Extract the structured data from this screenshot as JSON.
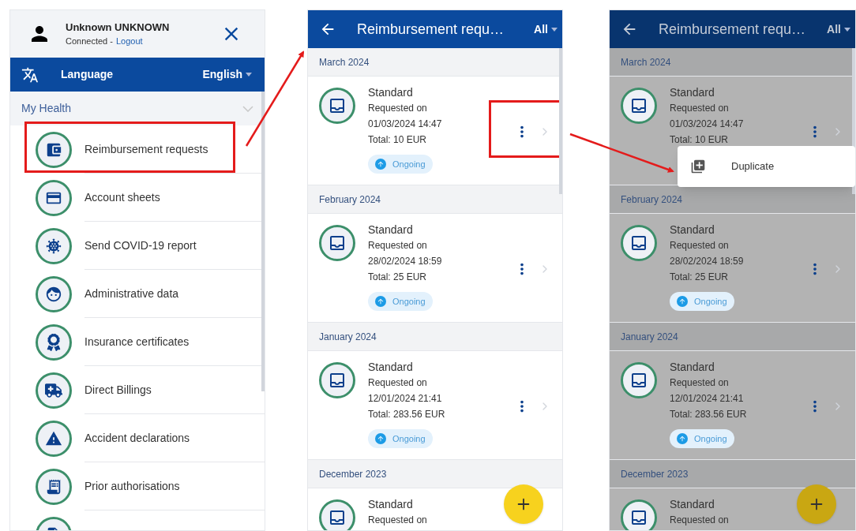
{
  "menu_screen": {
    "user": {
      "name": "Unknown UNKNOWN",
      "status": "Connected -",
      "logout": "Logout"
    },
    "language": {
      "label": "Language",
      "value": "English"
    },
    "section": {
      "title": "My Health",
      "expanded": true
    },
    "items": [
      {
        "kind": "entry",
        "label": "Reimbursement requests",
        "highlighted": true
      },
      {
        "kind": "entry",
        "label": "Account sheets",
        "highlighted": false
      },
      {
        "kind": "entry",
        "label": "Send COVID-19 report",
        "highlighted": false
      },
      {
        "kind": "entry",
        "label": "Administrative data",
        "highlighted": false
      },
      {
        "kind": "entry",
        "label": "Insurance certificates",
        "highlighted": false
      },
      {
        "kind": "entry",
        "label": "Direct Billings",
        "highlighted": false
      },
      {
        "kind": "entry",
        "label": "Accident declarations",
        "highlighted": false
      },
      {
        "kind": "entry",
        "label": "Prior authorisations",
        "highlighted": false
      },
      {
        "kind": "cut"
      }
    ]
  },
  "list_screen": {
    "title": "Reimbursement requ…",
    "filter": "All",
    "dimmed": false,
    "groups": [
      {
        "month": "March 2024",
        "requests": [
          {
            "type": "Standard",
            "requested_label": "Requested on",
            "date": "01/03/2024 14:47",
            "total": "Total: 10 EUR",
            "status": "Ongoing",
            "actions_highlighted": true
          }
        ]
      },
      {
        "month": "February 2024",
        "requests": [
          {
            "type": "Standard",
            "requested_label": "Requested on",
            "date": "28/02/2024 18:59",
            "total": "Total: 25 EUR",
            "status": "Ongoing",
            "actions_highlighted": false
          }
        ]
      },
      {
        "month": "January 2024",
        "requests": [
          {
            "type": "Standard",
            "requested_label": "Requested on",
            "date": "12/01/2024 21:41",
            "total": "Total: 283.56 EUR",
            "status": "Ongoing",
            "actions_highlighted": false
          }
        ]
      },
      {
        "month": "December 2023",
        "requests": [
          {
            "type": "Standard",
            "requested_label": "Requested on",
            "actions_highlighted": false
          }
        ]
      }
    ]
  },
  "dimmed_screen": {
    "title": "Reimbursement requ…",
    "filter": "All",
    "dimmed": true,
    "groups": [
      {
        "month": "March 2024",
        "requests": [
          {
            "type": "Standard",
            "requested_label": "Requested on",
            "date": "01/03/2024 14:47",
            "total": "Total: 10 EUR",
            "actions_highlighted": false
          }
        ]
      },
      {
        "month": "February 2024",
        "requests": [
          {
            "type": "Standard",
            "requested_label": "Requested on",
            "date": "28/02/2024 18:59",
            "total": "Total: 25 EUR",
            "status": "Ongoing",
            "actions_highlighted": false
          }
        ]
      },
      {
        "month": "January 2024",
        "requests": [
          {
            "type": "Standard",
            "requested_label": "Requested on",
            "date": "12/01/2024 21:41",
            "total": "Total: 283.56 EUR",
            "status": "Ongoing",
            "actions_highlighted": false
          }
        ]
      },
      {
        "month": "December 2023",
        "requests": [
          {
            "type": "Standard",
            "requested_label": "Requested on",
            "actions_highlighted": false
          }
        ]
      }
    ],
    "popup_menu": [
      {
        "label": "Duplicate"
      }
    ]
  }
}
